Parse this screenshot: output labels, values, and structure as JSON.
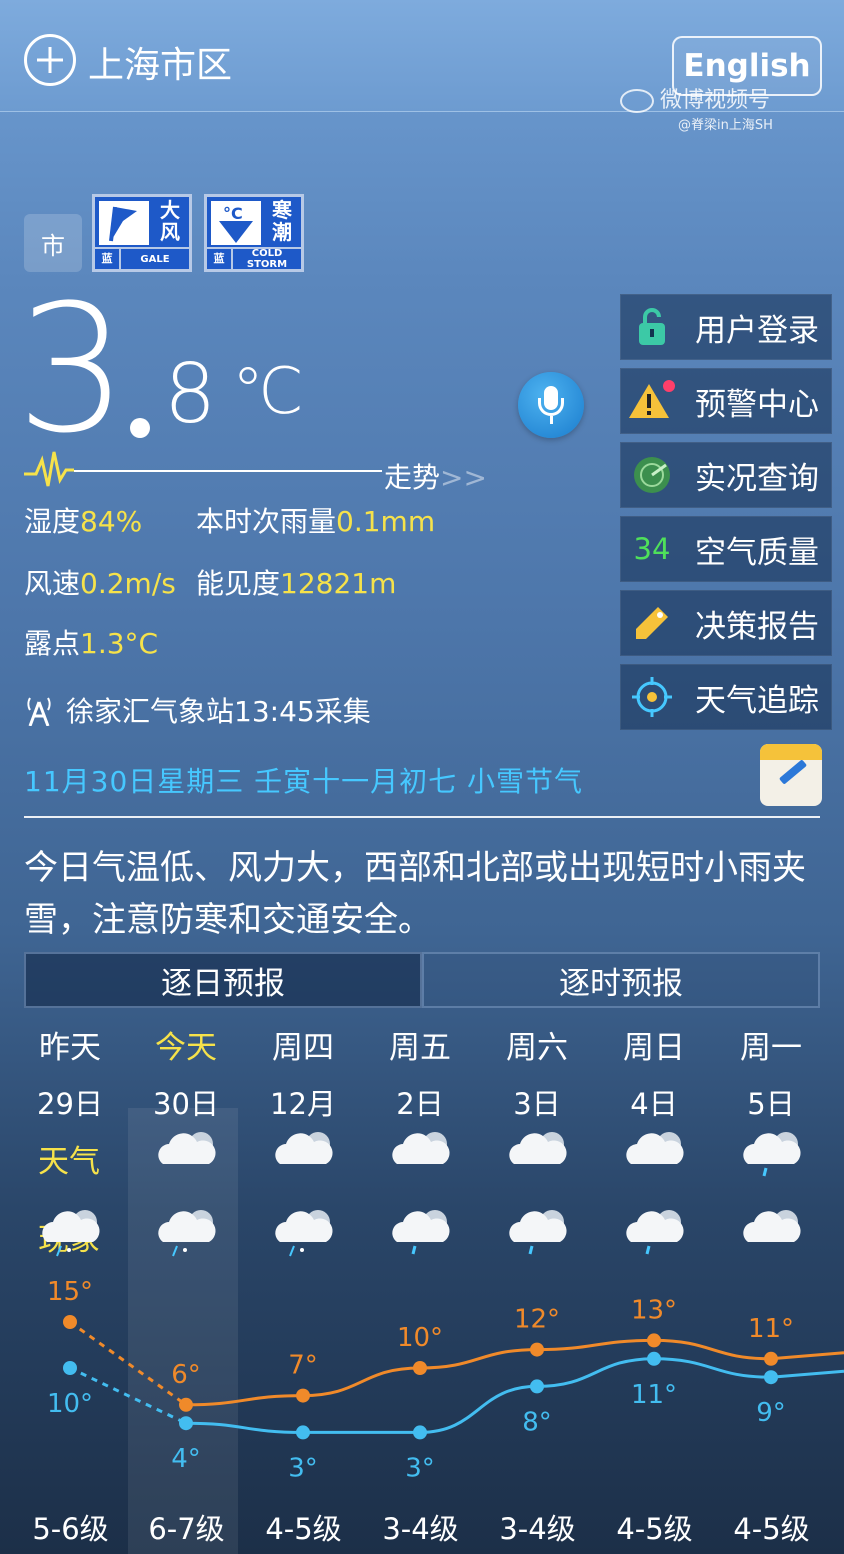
{
  "header": {
    "city": "上海市区",
    "lang_button": "English",
    "watermark": "微博视频号",
    "watermark_sub": "@脊梁in上海SH"
  },
  "level_badge": "市",
  "warnings": [
    {
      "icon": "flag-icon",
      "chars": "大风",
      "level": "蓝",
      "en": "GALE"
    },
    {
      "icon": "thermometer-down-icon",
      "chars": "寒潮",
      "level": "蓝",
      "en": "COLD STORM"
    }
  ],
  "current": {
    "temp_int": "3",
    "temp_dec": "8",
    "temp_unit": "℃",
    "trend_label": "走势",
    "trend_arrows": ">>",
    "humidity_label": "湿度",
    "humidity": "84%",
    "rain_label": "本时次雨量",
    "rain": "0.1mm",
    "wind_label": "风速",
    "wind": "0.2m/s",
    "visibility_label": "能见度",
    "visibility": "12821m",
    "dew_label": "露点",
    "dew": "1.3°C",
    "station": "徐家汇气象站13:45采集"
  },
  "side_menu": [
    {
      "label": "用户登录",
      "icon": "lock-icon"
    },
    {
      "label": "预警中心",
      "icon": "warning-icon"
    },
    {
      "label": "实况查询",
      "icon": "radar-icon"
    },
    {
      "label": "空气质量",
      "icon": "aqi-value",
      "value": "34"
    },
    {
      "label": "决策报告",
      "icon": "tag-icon"
    },
    {
      "label": "天气追踪",
      "icon": "target-icon"
    }
  ],
  "date_line": "11月30日星期三  壬寅十一月初七  小雪节气",
  "summary": "今日气温低、风力大，西部和北部或出现短时小雨夹雪，注意防寒和交通安全。",
  "tabs": {
    "daily": "逐日预报",
    "hourly": "逐时预报"
  },
  "rows": {
    "weather": "天气",
    "phenomenon": "现象"
  },
  "forecast": [
    {
      "day": "昨天",
      "date": "29日",
      "high": "15°",
      "low": "10°",
      "wind": "5-6级",
      "weather": "",
      "phen": "sleet"
    },
    {
      "day": "今天",
      "date": "30日",
      "high": "6°",
      "low": "4°",
      "wind": "6-7级",
      "weather": "cloudy",
      "phen": "sleet"
    },
    {
      "day": "周四",
      "date": "12月",
      "high": "7°",
      "low": "3°",
      "wind": "4-5级",
      "weather": "cloudy",
      "phen": "sleet"
    },
    {
      "day": "周五",
      "date": "2日",
      "high": "10°",
      "low": "3°",
      "wind": "3-4级",
      "weather": "cloudy",
      "phen": "rain"
    },
    {
      "day": "周六",
      "date": "3日",
      "high": "12°",
      "low": "8°",
      "wind": "3-4级",
      "weather": "cloudy",
      "phen": "rain"
    },
    {
      "day": "周日",
      "date": "4日",
      "high": "13°",
      "low": "11°",
      "wind": "4-5级",
      "weather": "cloudy",
      "phen": "rain"
    },
    {
      "day": "周一",
      "date": "5日",
      "high": "11°",
      "low": "9°",
      "wind": "4-5级",
      "weather": "rain",
      "phen": "cloudy"
    }
  ],
  "colors": {
    "high": "#f08a2a",
    "low": "#43bdf0",
    "accent": "#f6e24a",
    "date": "#46c8ff"
  }
}
